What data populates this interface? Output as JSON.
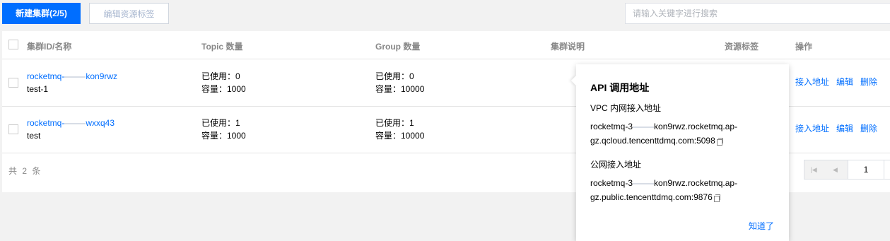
{
  "toolbar": {
    "create_label": "新建集群(2/5)",
    "edit_tags_label": "编辑资源标签",
    "search_placeholder": "请输入关键字进行搜索"
  },
  "table": {
    "headers": {
      "id_name": "集群ID/名称",
      "topic": "Topic 数量",
      "group": "Group 数量",
      "desc": "集群说明",
      "tags": "资源标签",
      "ops": "操作"
    },
    "rows": [
      {
        "id_prefix": "rocketmq-",
        "id_suffix": "kon9rwz",
        "name": "test-1",
        "topic_used": "已使用：0",
        "topic_cap": "容量：1000",
        "group_used": "已使用：0",
        "group_cap": "容量：10000",
        "op_access": "接入地址",
        "op_edit": "编辑",
        "op_delete": "删除"
      },
      {
        "id_prefix": "rocketmq-",
        "id_suffix": "wxxq43",
        "name": "test",
        "topic_used": "已使用：1",
        "topic_cap": "容量：1000",
        "group_used": "已使用：1",
        "group_cap": "容量：10000",
        "op_access": "接入地址",
        "op_edit": "编辑",
        "op_delete": "删除"
      }
    ],
    "total": "共 2 条",
    "page_value": "1"
  },
  "popover": {
    "title": "API 调用地址",
    "vpc_label": "VPC 内网接入地址",
    "vpc_addr_line1_prefix": "rocketmq-3",
    "vpc_addr_line1_suffix": "kon9rwz.rocketmq.ap-",
    "vpc_addr_line2": "gz.qcloud.tencenttdmq.com:5098",
    "public_label": "公网接入地址",
    "public_addr_line1_prefix": "rocketmq-3",
    "public_addr_line1_suffix": "kon9rwz.rocketmq.ap-",
    "public_addr_line2": "gz.public.tencenttdmq.com:9876",
    "ok_label": "知道了"
  },
  "colors": {
    "primary": "#006eff",
    "background": "#f2f2f2"
  }
}
